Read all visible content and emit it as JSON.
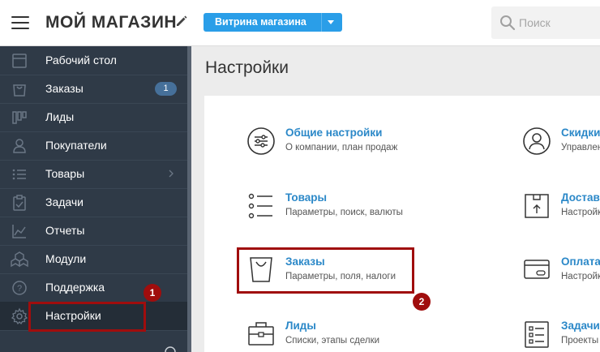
{
  "header": {
    "store_title": "МОЙ МАГАЗИН",
    "storefront_label": "Витрина магазина",
    "search_placeholder": "Поиск"
  },
  "sidebar": {
    "items": [
      {
        "label": "Рабочий стол",
        "icon": "dashboard-icon"
      },
      {
        "label": "Заказы",
        "icon": "orders-icon",
        "badge": "1"
      },
      {
        "label": "Лиды",
        "icon": "leads-icon"
      },
      {
        "label": "Покупатели",
        "icon": "customers-icon"
      },
      {
        "label": "Товары",
        "icon": "products-icon"
      },
      {
        "label": "Задачи",
        "icon": "tasks-icon"
      },
      {
        "label": "Отчеты",
        "icon": "reports-icon"
      },
      {
        "label": "Модули",
        "icon": "modules-icon"
      },
      {
        "label": "Поддержка",
        "icon": "support-icon"
      },
      {
        "label": "Настройки",
        "icon": "settings-icon"
      }
    ]
  },
  "main": {
    "page_title": "Настройки",
    "settings": [
      {
        "title": "Общие настройки",
        "desc": "О компании, план продаж",
        "icon": "sliders-icon"
      },
      {
        "title": "Скидки",
        "desc": "Управление",
        "icon": "user-circle-icon"
      },
      {
        "title": "Товары",
        "desc": "Параметры, поиск, валюты",
        "icon": "list-icon"
      },
      {
        "title": "Доставка",
        "desc": "Настройки",
        "icon": "box-icon"
      },
      {
        "title": "Заказы",
        "desc": "Параметры, поля, налоги",
        "icon": "bag-icon"
      },
      {
        "title": "Оплата",
        "desc": "Настройки",
        "icon": "card-icon"
      },
      {
        "title": "Лиды",
        "desc": "Списки, этапы сделки",
        "icon": "briefcase-icon"
      },
      {
        "title": "Задачи",
        "desc": "Проекты",
        "icon": "checklist-icon"
      }
    ]
  },
  "annotations": {
    "step1": "1",
    "step2": "2"
  },
  "colors": {
    "accent": "#2a9ee8",
    "sidebar_bg": "#2f3a47",
    "highlight": "#a00d0d",
    "link": "#2b88c8"
  }
}
